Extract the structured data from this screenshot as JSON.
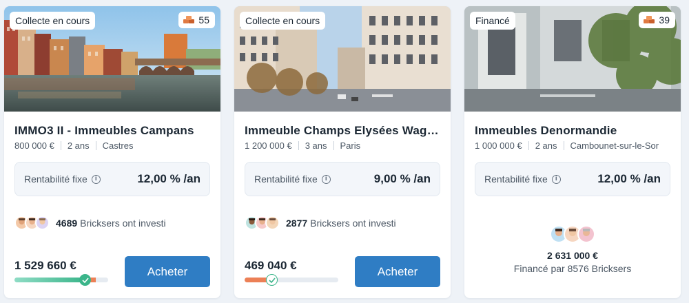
{
  "cards": [
    {
      "status": "Collecte en cours",
      "bricks_count": "55",
      "title": "IMMO3 II - Immeubles Campans",
      "price": "800 000 €",
      "duration": "2 ans",
      "city": "Castres",
      "rent_label": "Rentabilité fixe",
      "rent_value": "12,00 % /an",
      "investors_count": "4689",
      "investors_text": "Bricksers ont investi",
      "collected": "1 529 660 €",
      "progress": 0.75,
      "overflow": 0.06,
      "buy_label": "Acheter"
    },
    {
      "status": "Collecte en cours",
      "title": "Immeuble Champs Elysées Wagr…",
      "price": "1 200 000 €",
      "duration": "3 ans",
      "city": "Paris",
      "rent_label": "Rentabilité fixe",
      "rent_value": "9,00 % /an",
      "investors_count": "2877",
      "investors_text": "Bricksers ont investi",
      "collected": "469 040 €",
      "progress": 0.29,
      "buy_label": "Acheter"
    },
    {
      "status": "Financé",
      "bricks_count": "39",
      "title": "Immeubles Denormandie",
      "price": "1 000 000 €",
      "duration": "2 ans",
      "city": "Cambounet-sur-le-Sor",
      "rent_label": "Rentabilité fixe",
      "rent_value": "12,00 % /an",
      "funded_amount": "2 631 000 €",
      "funded_text": "Financé par 8576 Bricksers"
    }
  ],
  "colors": {
    "accent": "#2f7dc4",
    "progress_green": "#4cc4a0",
    "progress_orange": "#ec8056",
    "check_green": "#3bb58a"
  }
}
